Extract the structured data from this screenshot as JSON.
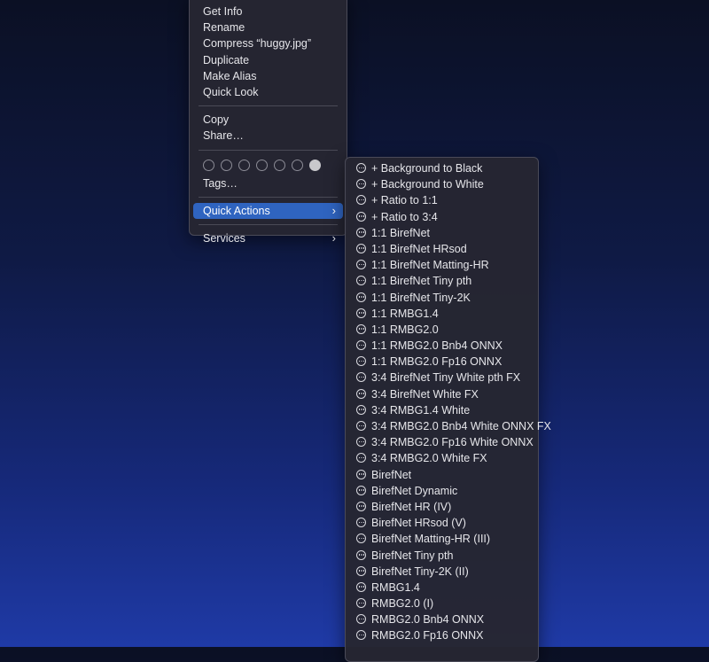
{
  "context_menu": {
    "group1": [
      "Get Info",
      "Rename",
      "Compress “huggy.jpg”",
      "Duplicate",
      "Make Alias",
      "Quick Look"
    ],
    "group2": [
      "Copy",
      "Share…"
    ],
    "tags_label": "Tags…",
    "quick_actions": "Quick Actions",
    "services": "Services",
    "chevron": "›"
  },
  "submenu": {
    "icon": "ellipsis-circle-icon",
    "items": [
      "+ Background to Black",
      "+ Background to White",
      "+ Ratio to 1:1",
      "+ Ratio to 3:4",
      "1:1 BirefNet",
      "1:1 BirefNet HRsod",
      "1:1 BirefNet Matting-HR",
      "1:1 BirefNet Tiny pth",
      "1:1 BirefNet Tiny-2K",
      "1:1 RMBG1.4",
      "1:1 RMBG2.0",
      "1:1 RMBG2.0 Bnb4 ONNX",
      "1:1 RMBG2.0 Fp16 ONNX",
      "3:4 BirefNet Tiny White pth FX",
      "3:4 BirefNet White FX",
      "3:4 RMBG1.4 White",
      "3:4 RMBG2.0 Bnb4 White ONNX FX",
      "3:4 RMBG2.0 Fp16 White ONNX",
      "3:4 RMBG2.0 White FX",
      "BirefNet",
      "BirefNet Dynamic",
      "BirefNet HR (IV)",
      "BirefNet HRsod (V)",
      "BirefNet Matting-HR (III)",
      "BirefNet Tiny pth",
      "BirefNet Tiny-2K (II)",
      "RMBG1.4",
      "RMBG2.0 (I)",
      "RMBG2.0 Bnb4 ONNX",
      "RMBG2.0 Fp16 ONNX"
    ]
  }
}
